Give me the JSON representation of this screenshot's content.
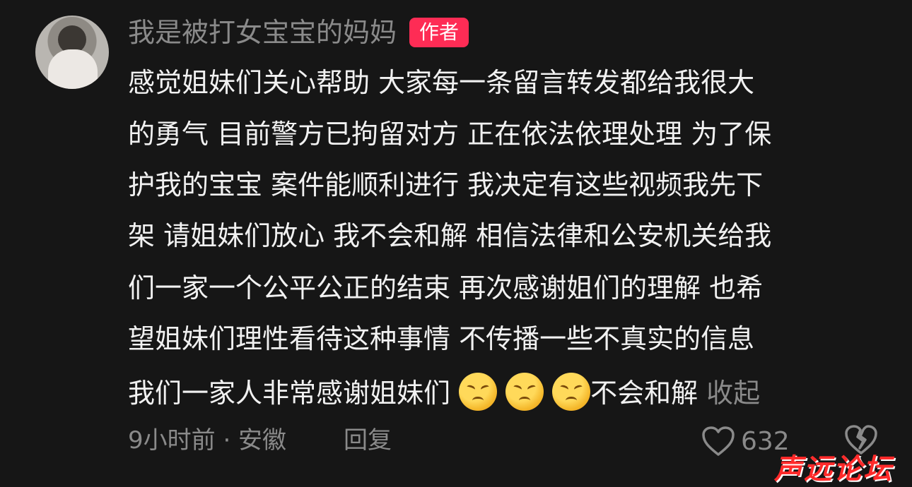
{
  "comment": {
    "username": "我是被打女宝宝的妈妈",
    "author_badge": "作者",
    "lines": [
      "感觉姐妹们关心帮助 大家每一条留言转发都给我很大",
      "的勇气 目前警方已拘留对方 正在依法依理处理 为了保",
      "护我的宝宝 案件能顺利进行 我决定有这些视频我先下",
      "架  请姐妹们放心 我不会和解 相信法律和公安机关给我",
      "们一家一个公平公正的结束 再次感谢姐们的理解 也希",
      "望姐妹们理性看待这种事情 不传播一些不真实的信息"
    ],
    "last_line_text": "我们一家人非常感谢姐妹们 ",
    "emoji_name": "persevering-face-emoji",
    "emoji_count": 3,
    "trailing_text": "不会和解",
    "collapse_label": "收起",
    "meta": "9小时前 · 安徽",
    "reply_label": "回复",
    "like_count": "632"
  },
  "watermark": "声远论坛",
  "colors": {
    "background": "#161616",
    "text": "#f1f1f1",
    "muted": "#8a8a8a",
    "badge": "#fe2c55",
    "watermark": "#ff2a2a"
  }
}
